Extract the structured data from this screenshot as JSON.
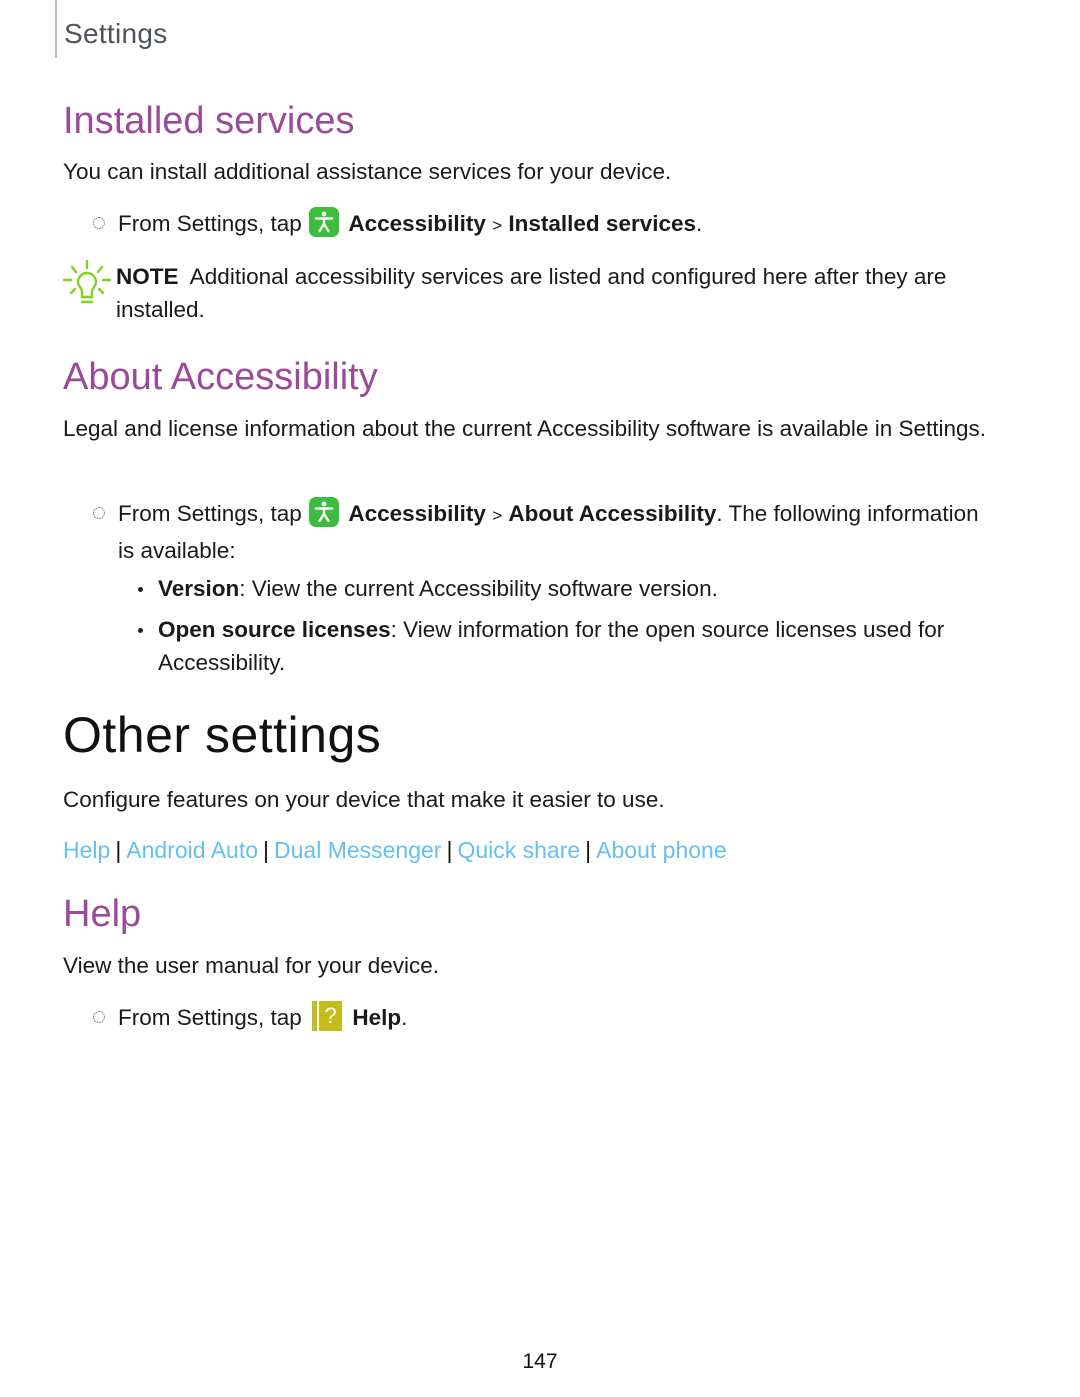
{
  "header": {
    "section_label": "Settings"
  },
  "installed_services": {
    "heading": "Installed services",
    "intro": "You can install additional assistance services for your device.",
    "step": {
      "prefix": "From Settings, tap",
      "icon": "accessibility-icon",
      "item1": "Accessibility",
      "sep": ">",
      "item2": "Installed services",
      "suffix": "."
    },
    "note": {
      "icon": "lightbulb-icon",
      "label": "NOTE",
      "text": "Additional accessibility services are listed and configured here after they are installed."
    }
  },
  "about_accessibility": {
    "heading": "About Accessibility",
    "intro": "Legal and license information about the current Accessibility software is available in Settings.",
    "step": {
      "prefix": "From Settings, tap",
      "icon": "accessibility-icon",
      "item1": "Accessibility",
      "sep": ">",
      "item2": "About Accessibility",
      "suffix": ". The following information is available:"
    },
    "bullets": [
      {
        "term": "Version",
        "text": ": View the current Accessibility software version."
      },
      {
        "term": "Open source licenses",
        "text": ": View information for the open source licenses used for Accessibility."
      }
    ]
  },
  "other_settings": {
    "title": "Other settings",
    "intro": "Configure features on your device that make it easier to use.",
    "links": [
      "Help",
      "Android Auto",
      "Dual Messenger",
      "Quick share",
      "About phone"
    ],
    "link_separator": "|"
  },
  "help": {
    "heading": "Help",
    "intro": "View the user manual for your device.",
    "step": {
      "prefix": "From Settings, tap",
      "icon": "help-icon",
      "icon_glyph": "?",
      "item1": "Help",
      "suffix": "."
    }
  },
  "colors": {
    "heading": "#9b4a9a",
    "link": "#64c0f2",
    "accessibility_icon": "#3dbd3d",
    "help_icon": "#c4bc1a",
    "note_icon": "#7ed321"
  },
  "page_number": "147"
}
